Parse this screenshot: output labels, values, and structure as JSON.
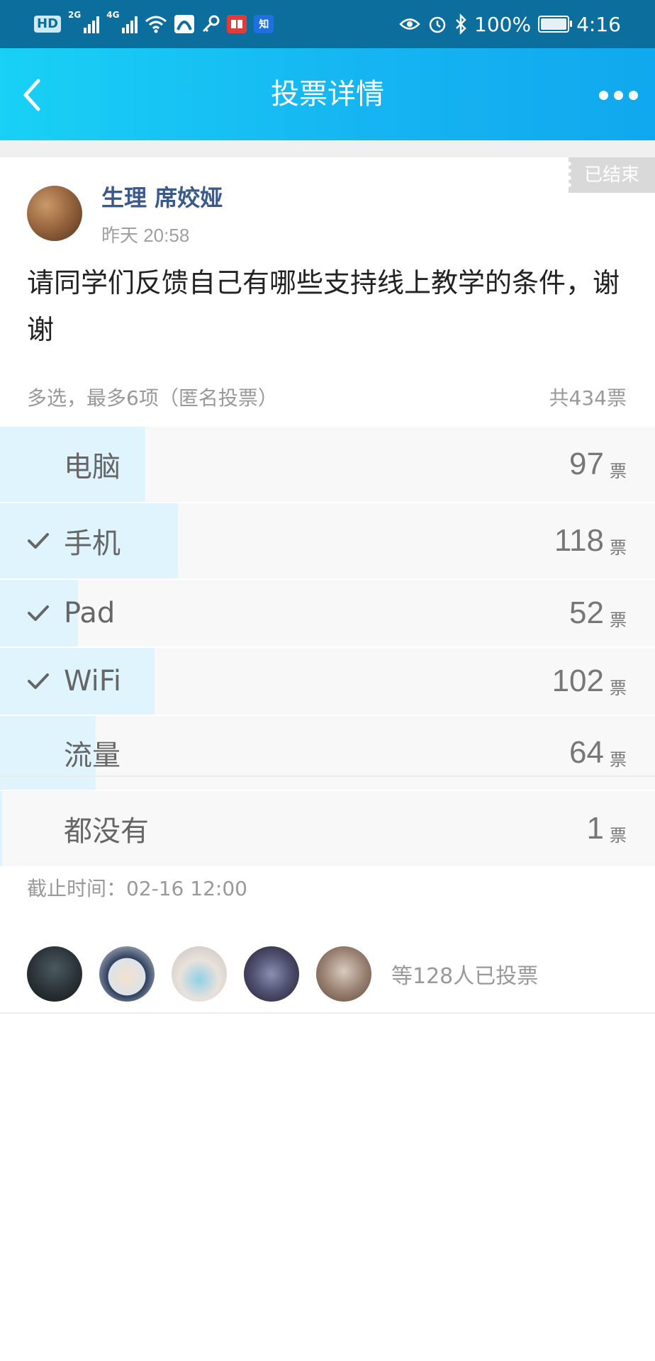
{
  "status_bar": {
    "left_badge": "HD",
    "signal1_label": "2G",
    "signal2_label": "4G",
    "zhihu_label": "知",
    "battery_text": "100%",
    "time": "4:16"
  },
  "header": {
    "title": "投票详情"
  },
  "post": {
    "status_tag": "已结束",
    "author": "生理 席姣娅",
    "time": "昨天 20:58",
    "question": "请同学们反馈自己有哪些支持线上教学的条件，谢谢"
  },
  "vote": {
    "meta": "多选，最多6项（匿名投票）",
    "total": "共434票",
    "unit": "票",
    "options": [
      {
        "label": "电脑",
        "count": "97",
        "checked": false
      },
      {
        "label": "手机",
        "count": "118",
        "checked": true
      },
      {
        "label": "Pad",
        "count": "52",
        "checked": true
      },
      {
        "label": "WiFi",
        "count": "102",
        "checked": true
      },
      {
        "label": "流量",
        "count": "64",
        "checked": false
      },
      {
        "label": "都没有",
        "count": "1",
        "checked": false
      }
    ],
    "deadline": "截止时间：02-16 12:00"
  },
  "voters": {
    "summary": "等128人已投票"
  },
  "colors": {
    "nav_gradient_start": "#18d1f5",
    "nav_gradient_end": "#10a8ee",
    "author_name": "#3b5a8c",
    "option_fill": "#dff4fc"
  }
}
